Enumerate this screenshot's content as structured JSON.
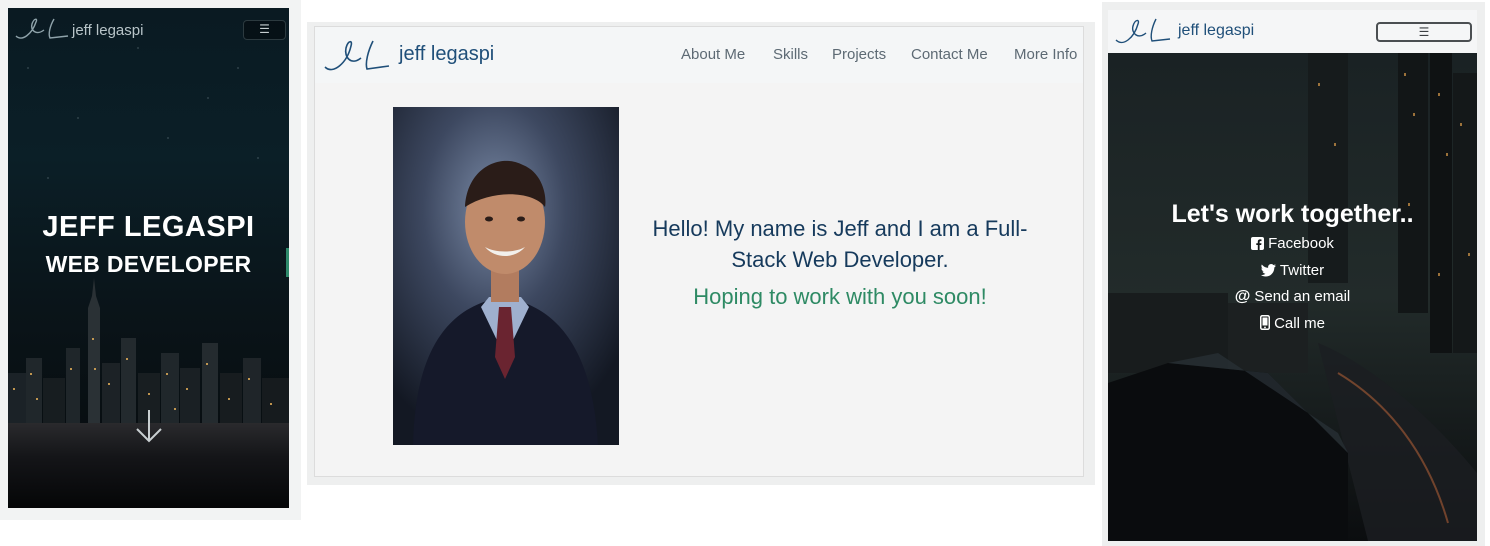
{
  "panel_hero": {
    "brand": "jeff legaspi",
    "menu_icon": "hamburger-icon",
    "title": "JEFF LEGASPI",
    "subtitle": "WEB DEVELOPER",
    "scroll_icon": "arrow-down-icon"
  },
  "panel_about": {
    "brand": "jeff legaspi",
    "nav": [
      "About Me",
      "Skills",
      "Projects",
      "Contact Me",
      "More Info"
    ],
    "intro": "Hello! My name is Jeff and I am a Full-Stack Web Developer.",
    "tagline": "Hoping to work with you soon!",
    "colors": {
      "heading": "#163a5c",
      "accent": "#2e8a64"
    }
  },
  "panel_contact": {
    "brand": "jeff legaspi",
    "menu_icon": "hamburger-icon",
    "title": "Let's work together..",
    "links": [
      {
        "label": "Facebook",
        "icon": "facebook-icon"
      },
      {
        "label": "Twitter",
        "icon": "twitter-icon"
      },
      {
        "label": "Send an email",
        "icon": "at-icon"
      },
      {
        "label": "Call me",
        "icon": "phone-icon"
      }
    ]
  }
}
